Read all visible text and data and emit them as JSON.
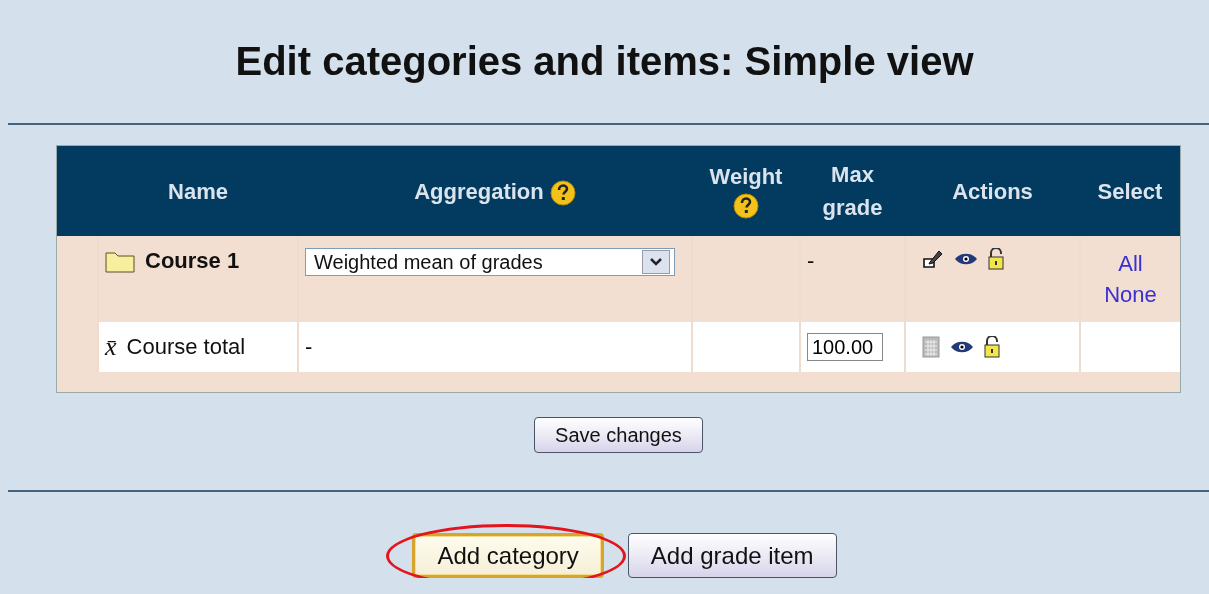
{
  "title": "Edit categories and items: Simple view",
  "table": {
    "columns": [
      {
        "label": "Name",
        "help": false
      },
      {
        "label": "Aggregation",
        "help": true
      },
      {
        "label": "Weight",
        "help": true
      },
      {
        "label": "Max grade",
        "help": false
      },
      {
        "label": "Actions",
        "help": false
      },
      {
        "label": "Select",
        "help": false
      }
    ],
    "rows": [
      {
        "kind": "category",
        "name": "Course 1",
        "aggregation": {
          "kind": "select",
          "value": "Weighted mean of grades"
        },
        "max_grade": {
          "kind": "text",
          "value": "-"
        },
        "select_links": [
          "All",
          "None"
        ]
      },
      {
        "kind": "total",
        "symbol": "x̄",
        "name": "Course total",
        "aggregation": {
          "kind": "text",
          "value": "-"
        },
        "max_grade": {
          "kind": "input",
          "value": "100.00"
        }
      }
    ]
  },
  "save_button": "Save changes",
  "buttons": [
    {
      "label": "Add category",
      "highlighted": true
    },
    {
      "label": "Add grade item",
      "highlighted": false
    }
  ]
}
